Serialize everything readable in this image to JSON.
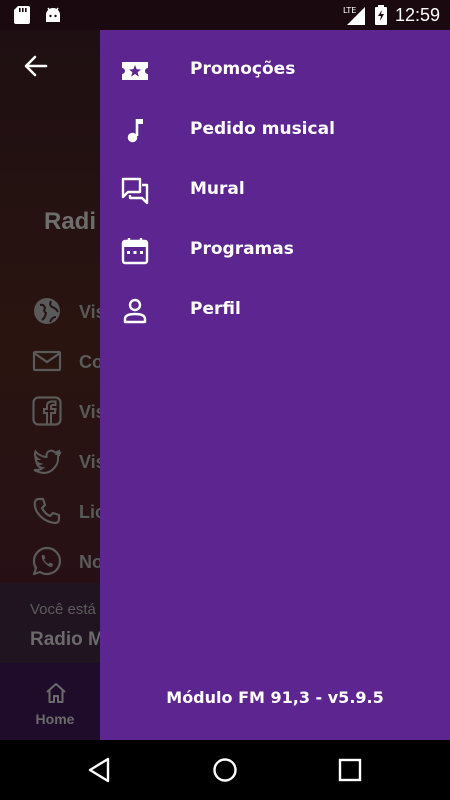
{
  "status_bar": {
    "time": "12:59",
    "network": "LTE",
    "icons": [
      "sd-card-icon",
      "android-icon",
      "signal-icon",
      "battery-charging-icon"
    ]
  },
  "app": {
    "title": "Radi",
    "links": [
      {
        "label": "Vis",
        "icon": "globe-icon"
      },
      {
        "label": "Co",
        "icon": "mail-icon"
      },
      {
        "label": "Vis",
        "icon": "facebook-icon"
      },
      {
        "label": "Vis",
        "icon": "twitter-icon"
      },
      {
        "label": "Lic",
        "icon": "phone-icon"
      },
      {
        "label": "No",
        "icon": "whatsapp-icon"
      }
    ],
    "now_playing": {
      "caption": "Você está",
      "station": "Radio M"
    },
    "bottom_nav": {
      "home_label": "Home"
    }
  },
  "drawer": {
    "items": [
      {
        "label": "Promoções",
        "icon": "ticket-star-icon"
      },
      {
        "label": "Pedido musical",
        "icon": "music-note-icon"
      },
      {
        "label": "Mural",
        "icon": "forum-icon"
      },
      {
        "label": "Programas",
        "icon": "calendar-icon"
      },
      {
        "label": "Perfil",
        "icon": "person-icon"
      }
    ],
    "footer": "Módulo FM 91,3 - v5.9.5"
  },
  "colors": {
    "drawer_bg": "#5c2590",
    "drawer_text": "#ffffff",
    "scrim_text": "#6a6a6a"
  }
}
